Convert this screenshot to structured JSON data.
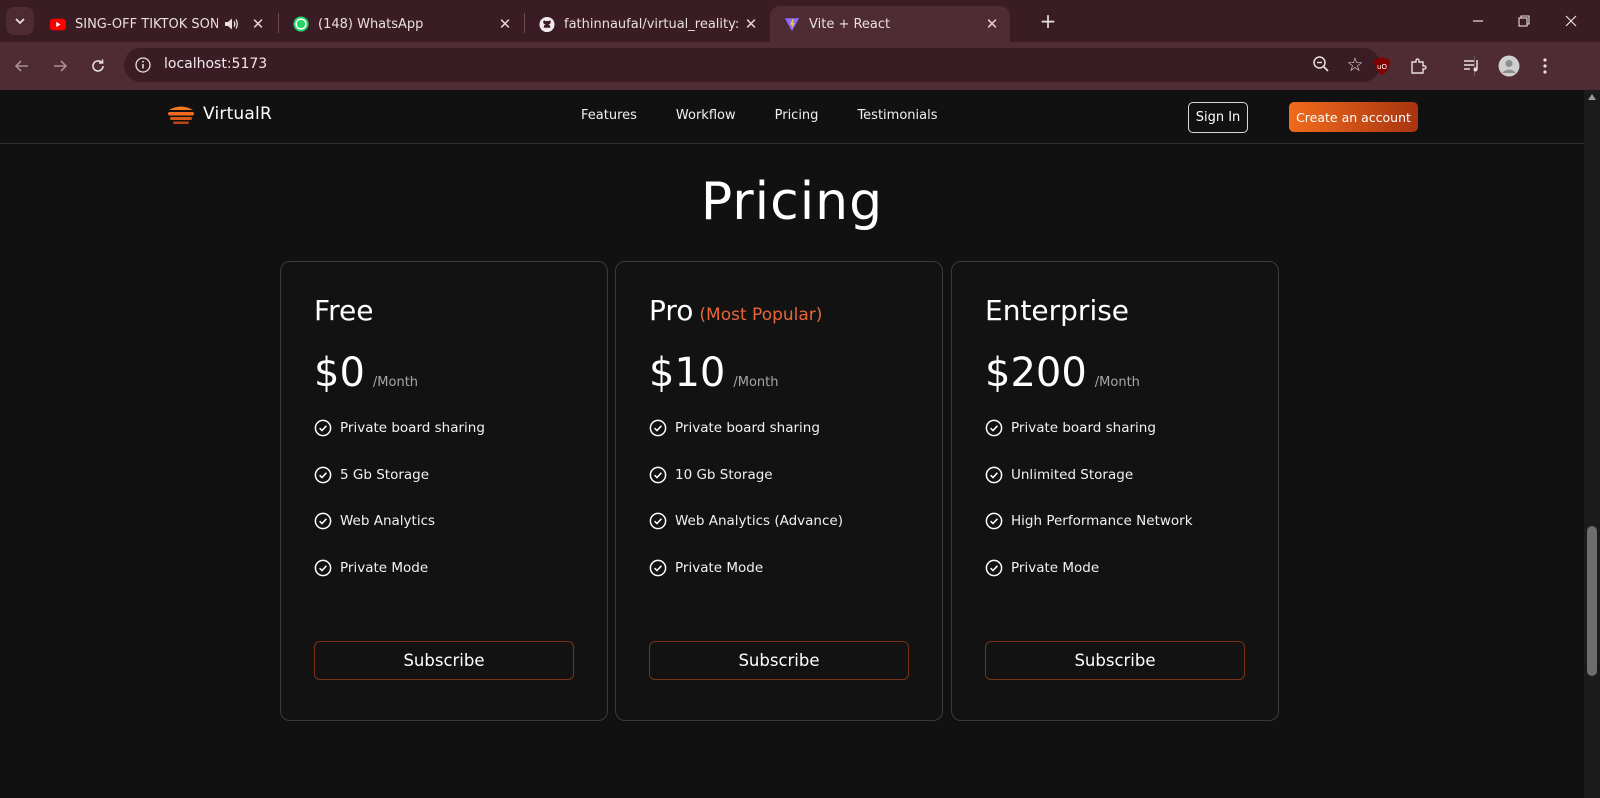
{
  "browser": {
    "tabs": [
      {
        "title": "SING-OFF TIKTOK SONGS P",
        "icon": "youtube-icon",
        "audio": true
      },
      {
        "title": "(148) WhatsApp",
        "icon": "whatsapp-icon"
      },
      {
        "title": "fathinnaufal/virtual_reality: virtu",
        "icon": "github-icon"
      },
      {
        "title": "Vite + React",
        "icon": "vite-icon",
        "active": true
      }
    ],
    "url": "localhost:5173",
    "colors": {
      "frame": "#3a1d24",
      "toolbar": "#4f2b33"
    }
  },
  "site": {
    "brand": "VirtualR",
    "nav": [
      "Features",
      "Workflow",
      "Pricing",
      "Testimonials"
    ],
    "signin_label": "Sign In",
    "create_label": "Create an account",
    "accent_color": "#f26b1d"
  },
  "pricing": {
    "heading": "Pricing",
    "plans": [
      {
        "name": "Free",
        "tag": "",
        "price": "$0",
        "period": "/Month",
        "features": [
          "Private board sharing",
          "5 Gb Storage",
          "Web Analytics",
          "Private Mode"
        ],
        "cta": "Subscribe"
      },
      {
        "name": "Pro",
        "tag": "(Most Popular)",
        "price": "$10",
        "period": "/Month",
        "features": [
          "Private board sharing",
          "10 Gb Storage",
          "Web Analytics (Advance)",
          "Private Mode"
        ],
        "cta": "Subscribe"
      },
      {
        "name": "Enterprise",
        "tag": "",
        "price": "$200",
        "period": "/Month",
        "features": [
          "Private board sharing",
          "Unlimited Storage",
          "High Performance Network",
          "Private Mode"
        ],
        "cta": "Subscribe"
      }
    ]
  }
}
